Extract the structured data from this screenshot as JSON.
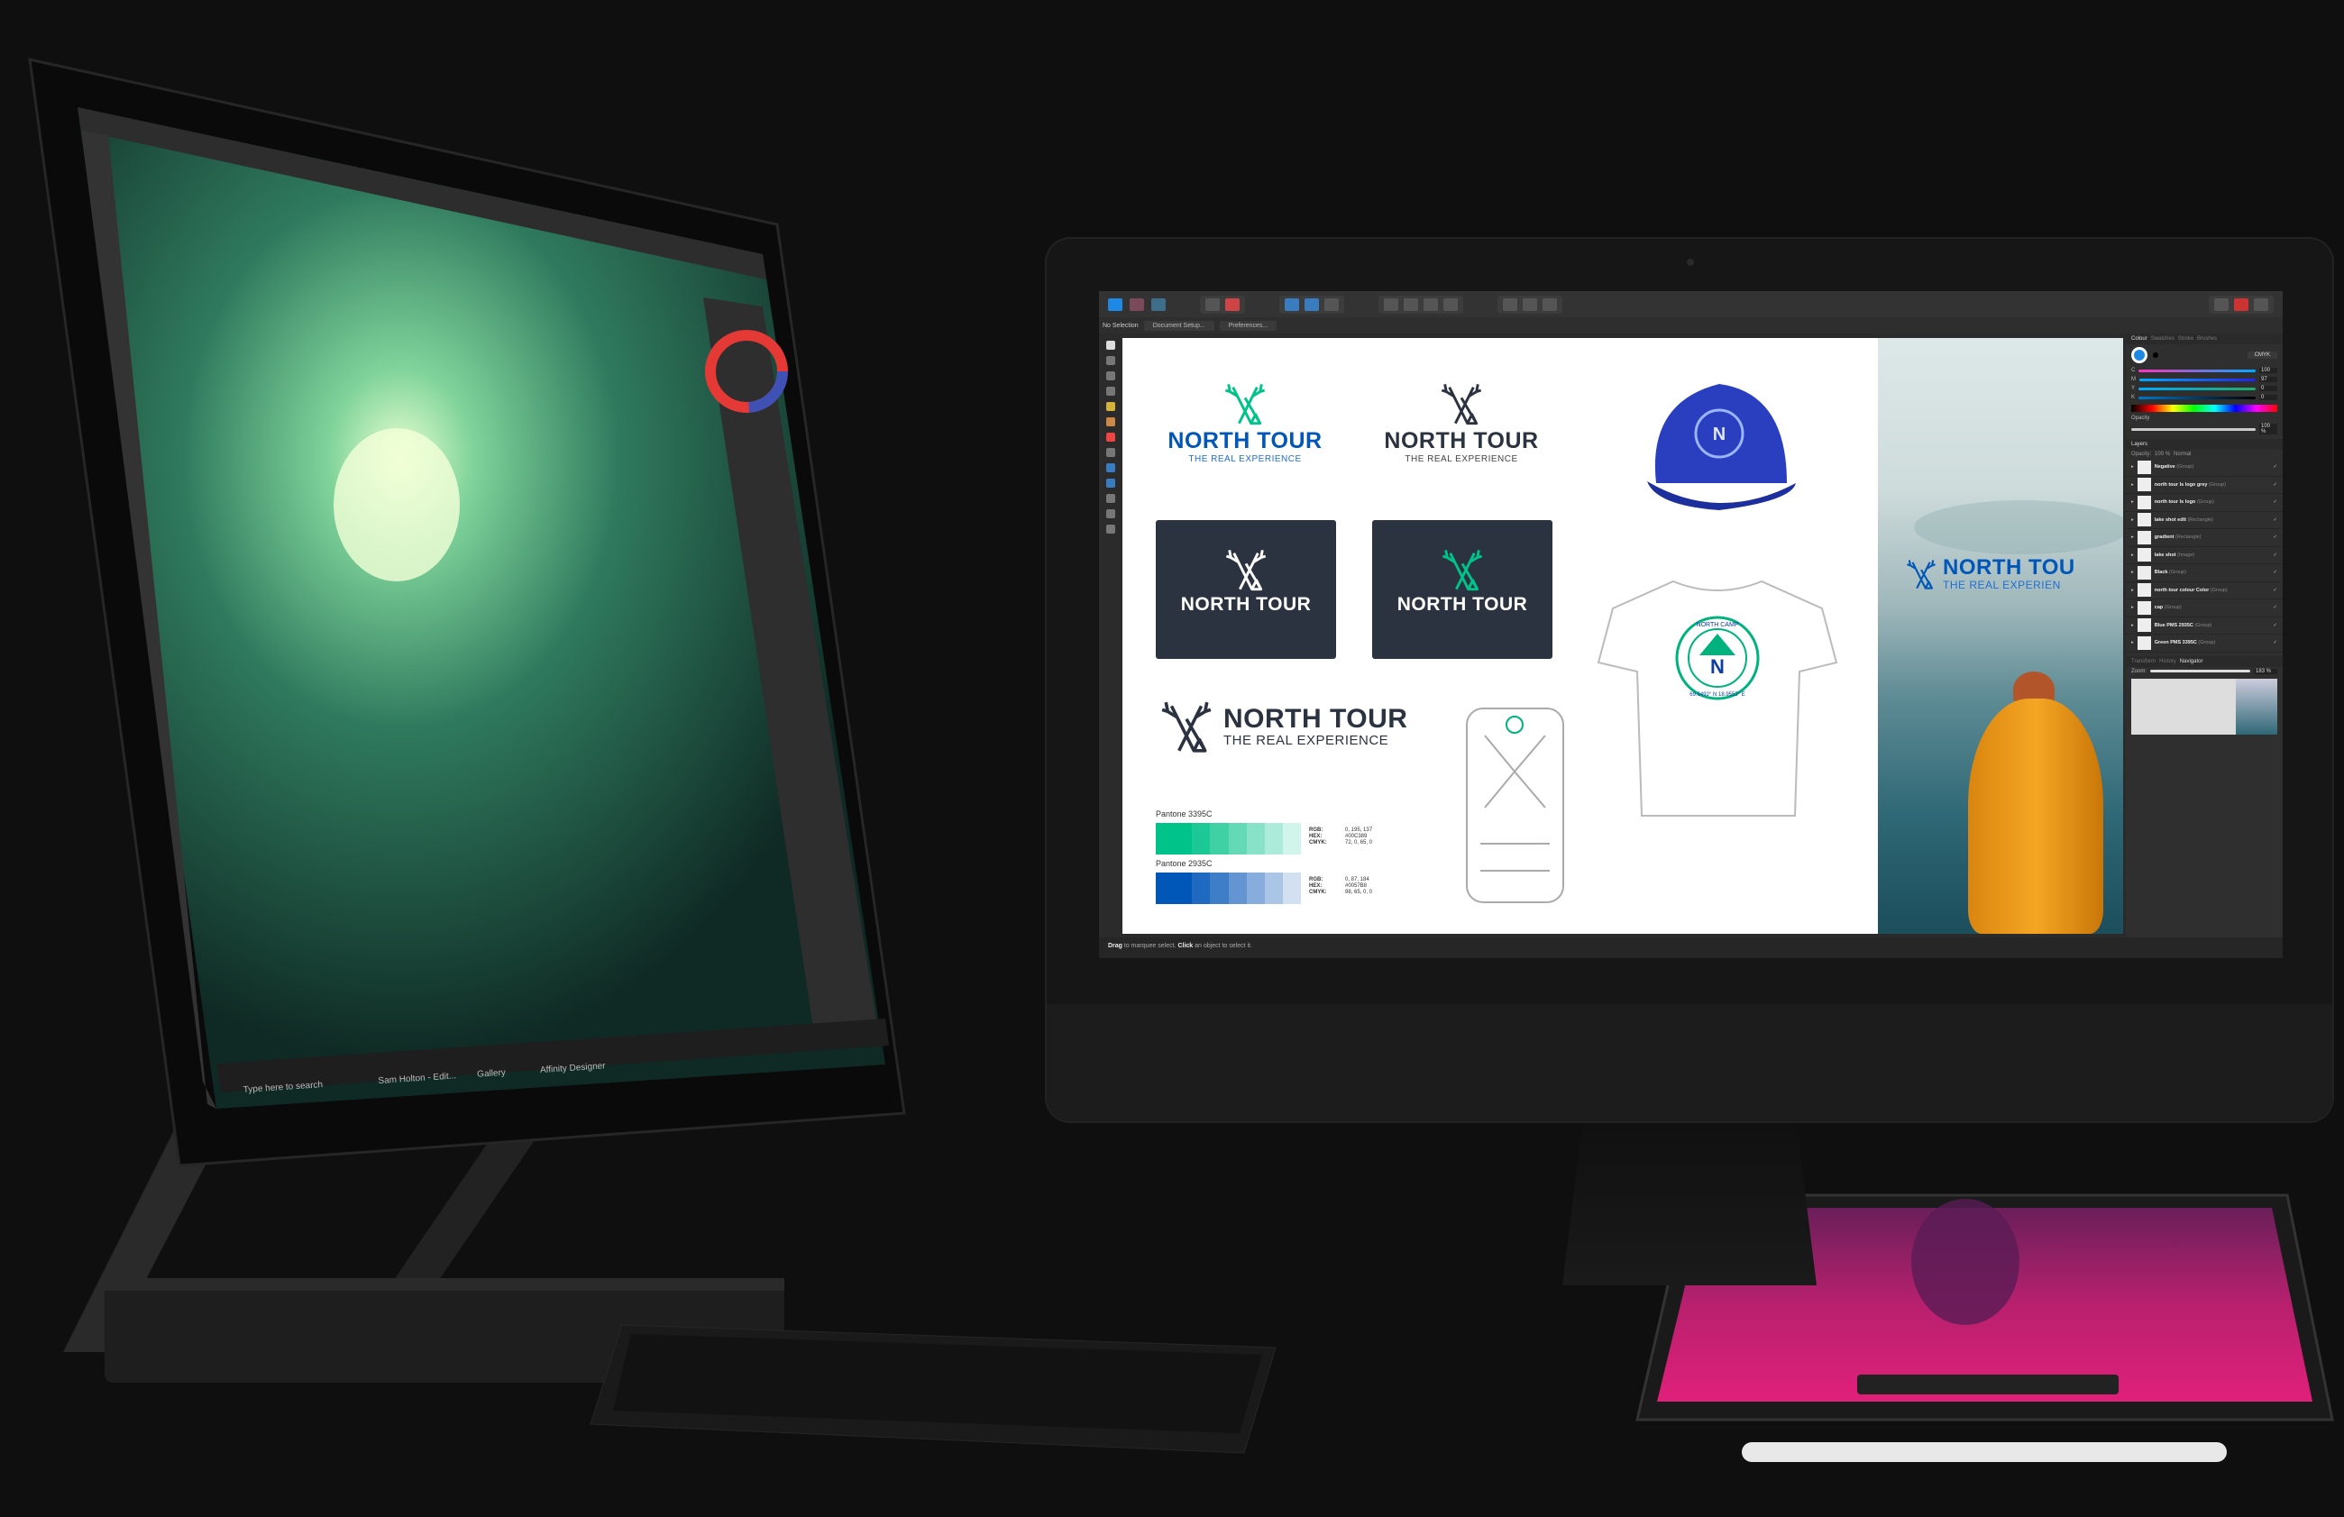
{
  "imac_app": {
    "context_bar": {
      "selection": "No Selection",
      "document_setup": "Document Setup...",
      "preferences": "Preferences..."
    },
    "logos": {
      "brand": "NORTH TOUR",
      "tagline": "THE REAL EXPERIENCE",
      "colors": {
        "green": "#00c389",
        "blue": "#0057b8",
        "dark": "#2b3340"
      }
    },
    "tshirt": {
      "badge_title": "NORTH CAMP",
      "badge_letter": "N",
      "badge_coords": "69.6492° N 18.9553° E"
    },
    "pantone": [
      {
        "name": "Pantone 3395C",
        "rgb": "0, 195, 137",
        "hex": "#00C389",
        "cmyk": "72, 0, 65, 0",
        "color": "#00c389"
      },
      {
        "name": "Pantone 2935C",
        "rgb": "0, 87, 184",
        "hex": "#0057B8",
        "cmyk": "98, 65, 0, 0",
        "color": "#0057b8"
      }
    ],
    "spec_labels": {
      "rgb": "RGB:",
      "hex": "HEX:",
      "cmyk": "CMYK:"
    },
    "lake_logo": {
      "brand": "NORTH TOU",
      "tagline": "THE REAL EXPERIEN"
    },
    "colour_panel": {
      "tabs": [
        "Colour",
        "Swatches",
        "Stroke",
        "Brushes"
      ],
      "model": "CMYK",
      "channels": [
        {
          "label": "C",
          "value": "100"
        },
        {
          "label": "M",
          "value": "97"
        },
        {
          "label": "Y",
          "value": "0"
        },
        {
          "label": "K",
          "value": "0"
        }
      ],
      "opacity_label": "Opacity",
      "opacity_value": "100 %"
    },
    "layers_panel": {
      "title": "Layers",
      "opacity_label": "Opacity:",
      "opacity_value": "100 %",
      "blend_mode": "Normal",
      "layers": [
        {
          "name": "Negative",
          "type": "(Group)"
        },
        {
          "name": "north tour ls logo grey",
          "type": "(Group)"
        },
        {
          "name": "north tour ls logo",
          "type": "(Group)"
        },
        {
          "name": "lake shot edit",
          "type": "(Rectangle)"
        },
        {
          "name": "gradient",
          "type": "(Rectangle)"
        },
        {
          "name": "lake shot",
          "type": "(Image)"
        },
        {
          "name": "Black",
          "type": "(Group)"
        },
        {
          "name": "north tour colour Color",
          "type": "(Group)"
        },
        {
          "name": "cap",
          "type": "(Group)"
        },
        {
          "name": "Blue PMS 2935C",
          "type": "(Group)"
        },
        {
          "name": "Green PMS 3395C",
          "type": "(Group)"
        }
      ]
    },
    "navigator": {
      "tabs": [
        "Transform",
        "History",
        "Navigator"
      ],
      "zoom_label": "Zoom:",
      "zoom_value": "183 %"
    },
    "status": {
      "drag": "Drag",
      "drag_text": " to marquee select. ",
      "click": "Click",
      "click_text": " an object to select it."
    }
  },
  "surface_app": {
    "taskbar": {
      "search_placeholder": "Type here to search",
      "apps": [
        "Sam Holton - Edit...",
        "Gallery",
        "Affinity Designer"
      ]
    }
  }
}
